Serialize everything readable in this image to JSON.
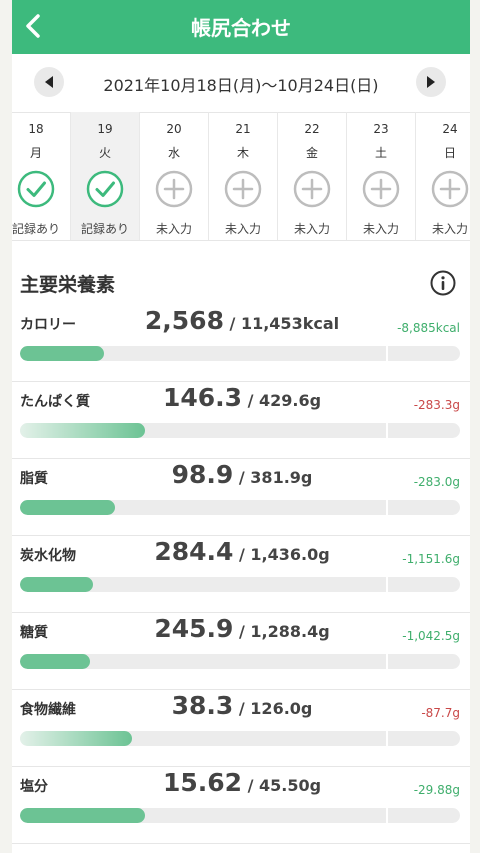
{
  "header": {
    "title": "帳尻合わせ"
  },
  "week": {
    "range": "2021年10月18日(月)〜10月24日(日)"
  },
  "days": [
    {
      "num": "18",
      "wd": "月",
      "status": "記録あり",
      "recorded": true,
      "selected": false
    },
    {
      "num": "19",
      "wd": "火",
      "status": "記録あり",
      "recorded": true,
      "selected": true
    },
    {
      "num": "20",
      "wd": "水",
      "status": "未入力",
      "recorded": false,
      "selected": false
    },
    {
      "num": "21",
      "wd": "木",
      "status": "未入力",
      "recorded": false,
      "selected": false
    },
    {
      "num": "22",
      "wd": "金",
      "status": "未入力",
      "recorded": false,
      "selected": false
    },
    {
      "num": "23",
      "wd": "土",
      "status": "未入力",
      "recorded": false,
      "selected": false
    },
    {
      "num": "24",
      "wd": "日",
      "status": "未入力",
      "recorded": false,
      "selected": false
    }
  ],
  "section": {
    "title": "主要栄養素"
  },
  "nutrients": [
    {
      "name": "カロリー",
      "value": "2,568",
      "sep": " / ",
      "total": "11,453kcal",
      "diff": "-8,885kcal",
      "diff_color": "green",
      "progress": 0.19,
      "fade": false
    },
    {
      "name": "たんぱく質",
      "value": "146.3",
      "sep": " / ",
      "total": "429.6g",
      "diff": "-283.3g",
      "diff_color": "red",
      "progress": 0.285,
      "fade": true
    },
    {
      "name": "脂質",
      "value": "98.9",
      "sep": " / ",
      "total": "381.9g",
      "diff": "-283.0g",
      "diff_color": "green",
      "progress": 0.215,
      "fade": false
    },
    {
      "name": "炭水化物",
      "value": "284.4",
      "sep": " / ",
      "total": "1,436.0g",
      "diff": "-1,151.6g",
      "diff_color": "green",
      "progress": 0.165,
      "fade": false
    },
    {
      "name": "糖質",
      "value": "245.9",
      "sep": " / ",
      "total": "1,288.4g",
      "diff": "-1,042.5g",
      "diff_color": "green",
      "progress": 0.16,
      "fade": false
    },
    {
      "name": "食物繊維",
      "value": "38.3",
      "sep": " / ",
      "total": "126.0g",
      "diff": "-87.7g",
      "diff_color": "red",
      "progress": 0.255,
      "fade": true
    },
    {
      "name": "塩分",
      "value": "15.62",
      "sep": " / ",
      "total": "45.50g",
      "diff": "-29.88g",
      "diff_color": "green",
      "progress": 0.285,
      "fade": false
    }
  ],
  "icons": {
    "back": "chevron-left-icon",
    "prev": "triangle-left-icon",
    "next": "triangle-right-icon",
    "recorded": "check-circle-icon",
    "empty": "plus-circle-icon",
    "info": "info-icon"
  },
  "colors": {
    "accent": "#3dba7d",
    "bar": "#6cc394",
    "positive": "#3fae6c",
    "negative": "#c94848"
  }
}
